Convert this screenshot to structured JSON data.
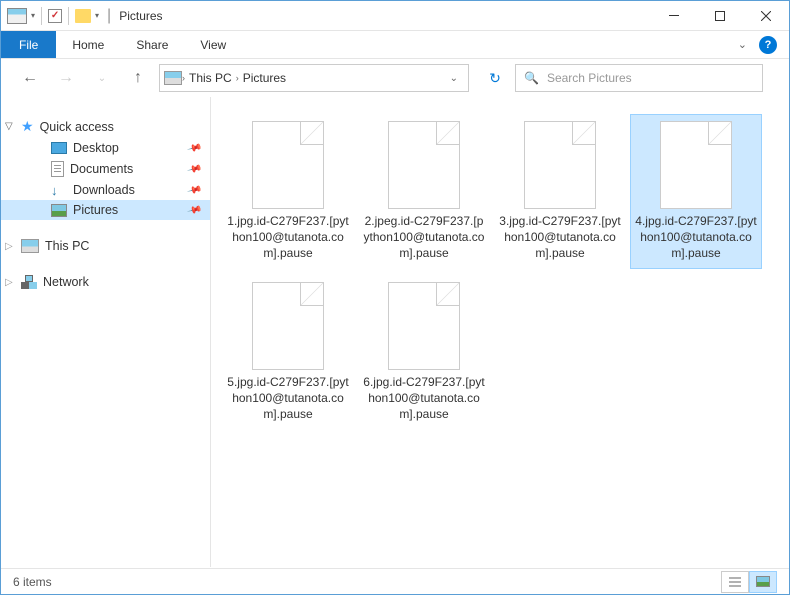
{
  "window": {
    "title": "Pictures"
  },
  "ribbon": {
    "file": "File",
    "tabs": [
      "Home",
      "Share",
      "View"
    ]
  },
  "breadcrumb": {
    "segments": [
      "This PC",
      "Pictures"
    ]
  },
  "search": {
    "placeholder": "Search Pictures"
  },
  "sidebar": {
    "quick_access": {
      "label": "Quick access",
      "items": [
        {
          "label": "Desktop",
          "icon": "desktop"
        },
        {
          "label": "Documents",
          "icon": "doc"
        },
        {
          "label": "Downloads",
          "icon": "dl"
        },
        {
          "label": "Pictures",
          "icon": "pic",
          "selected": true
        }
      ]
    },
    "this_pc": {
      "label": "This PC"
    },
    "network": {
      "label": "Network"
    }
  },
  "files": [
    {
      "name": "1.jpg.id-C279F237.[python100@tutanota.com].pause"
    },
    {
      "name": "2.jpeg.id-C279F237.[python100@tutanota.com].pause"
    },
    {
      "name": "3.jpg.id-C279F237.[python100@tutanota.com].pause"
    },
    {
      "name": "4.jpg.id-C279F237.[python100@tutanota.com].pause",
      "selected": true
    },
    {
      "name": "5.jpg.id-C279F237.[python100@tutanota.com].pause"
    },
    {
      "name": "6.jpg.id-C279F237.[python100@tutanota.com].pause"
    }
  ],
  "statusbar": {
    "count": "6 items"
  }
}
